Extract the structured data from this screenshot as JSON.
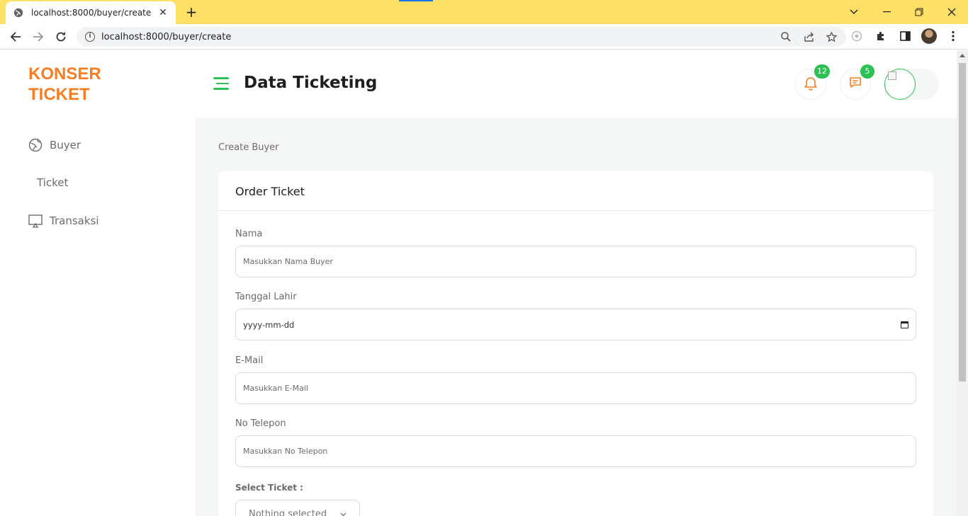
{
  "browser": {
    "tab_title": "localhost:8000/buyer/create",
    "url": "localhost:8000/buyer/create",
    "tab_close": "✕",
    "new_tab": "+"
  },
  "brand": {
    "line1": "KONSER",
    "line2": "TICKET"
  },
  "sidebar": {
    "items": [
      {
        "label": "Buyer",
        "icon": "globe-icon"
      },
      {
        "label": "Ticket",
        "icon": ""
      },
      {
        "label": "Transaksi",
        "icon": "monitor-icon"
      }
    ]
  },
  "header": {
    "title": "Data Ticketing",
    "notifications_count": "12",
    "messages_count": "5"
  },
  "breadcrumb": "Create Buyer",
  "form": {
    "card_title": "Order Ticket",
    "nama_label": "Nama",
    "nama_placeholder": "Masukkan Nama Buyer",
    "tanggal_label": "Tanggal Lahir",
    "tanggal_placeholder": "yyyy-mm-dd",
    "email_label": "E-Mail",
    "email_placeholder": "Masukkan E-Mail",
    "telepon_label": "No Telepon",
    "telepon_placeholder": "Masukkan No Telepon",
    "select_label": "Select Ticket :",
    "select_value": "Nothing selected"
  },
  "colors": {
    "brand": "#f77e22",
    "accent": "#2bc155",
    "tabbar": "#ffe066"
  }
}
